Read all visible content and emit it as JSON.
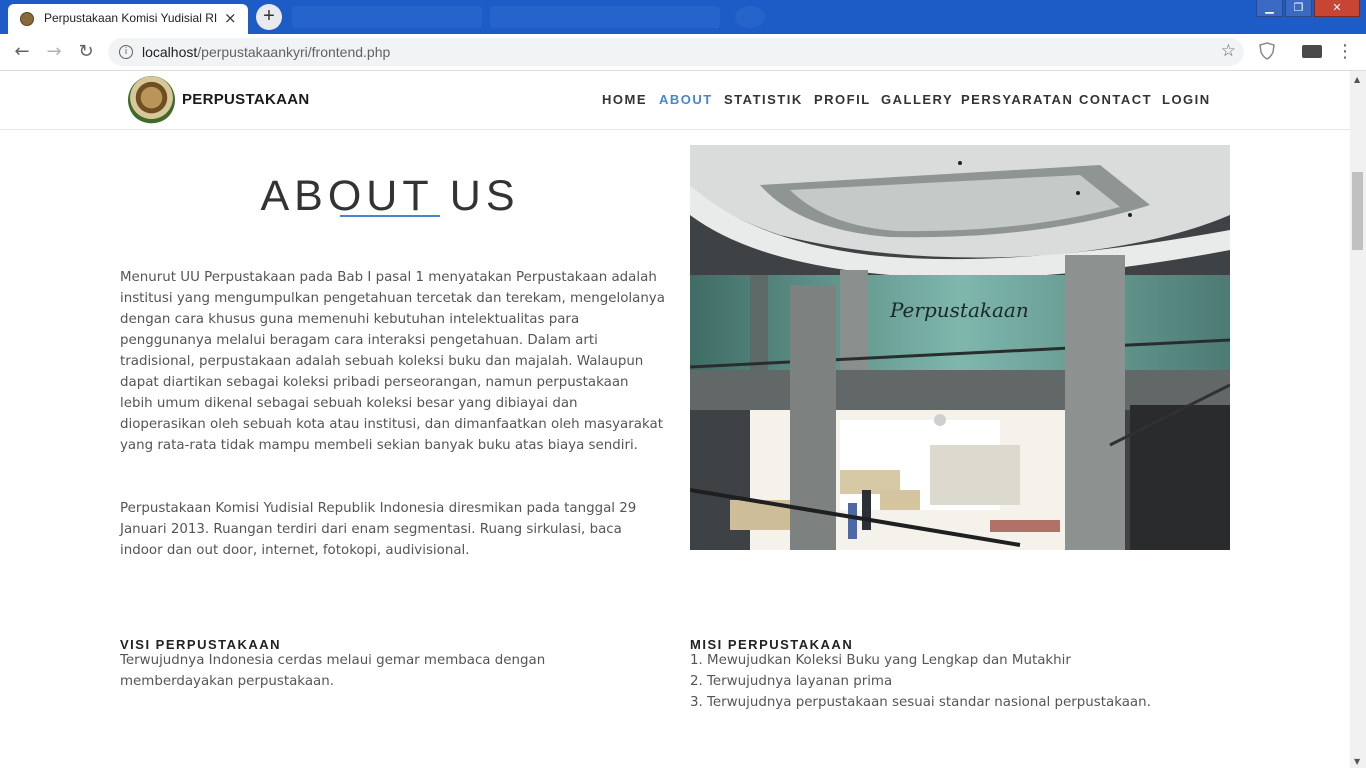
{
  "browser": {
    "tab_title": "Perpustakaan Komisi Yudisial RI",
    "tab_close": "×",
    "new_tab": "+",
    "url_host": "localhost",
    "url_path": "/perpustakaankyri/frontend.php",
    "back": "←",
    "forward": "→",
    "reload": "↻",
    "info": "i",
    "bookmark": "☆",
    "menu": "⋮",
    "window": {
      "minimize": "▁",
      "maximize": "❐",
      "close": "✕"
    }
  },
  "site": {
    "logo_text": "PERPUSTAKAAN",
    "nav": [
      {
        "label": "HOME",
        "active": false
      },
      {
        "label": "ABOUT",
        "active": true
      },
      {
        "label": "STATISTIK",
        "active": false
      },
      {
        "label": "PROFIL",
        "active": false
      },
      {
        "label": "GALLERY",
        "active": false
      },
      {
        "label": "PERSYARATAN",
        "active": false
      },
      {
        "label": "CONTACT",
        "active": false
      },
      {
        "label": "LOGIN",
        "active": false
      }
    ],
    "accent_color": "#4a86cf"
  },
  "about": {
    "title": "ABOUT US",
    "paragraph1": "Menurut UU Perpustakaan pada Bab I pasal 1 menyatakan Perpustakaan adalah institusi yang mengumpulkan pengetahuan tercetak dan terekam, mengelolanya dengan cara khusus guna memenuhi kebutuhan intelektualitas para penggunanya melalui beragam cara interaksi pengetahuan. Dalam arti tradisional, perpustakaan adalah sebuah koleksi buku dan majalah. Walaupun dapat diartikan sebagai koleksi pribadi perseorangan, namun perpustakaan lebih umum dikenal sebagai sebuah koleksi besar yang dibiayai dan dioperasikan oleh sebuah kota atau institusi, dan dimanfaatkan oleh masyarakat yang rata-rata tidak mampu membeli sekian banyak buku atas biaya sendiri.",
    "paragraph2": "Perpustakaan Komisi Yudisial Republik Indonesia diresmikan pada tanggal 29 Januari 2013. Ruangan terdiri dari enam segmentasi. Ruang sirkulasi, baca indoor dan out door, internet, fotokopi, audivisional.",
    "photo_sign": "Perpustakaan"
  },
  "visi": {
    "heading": "VISI PERPUSTAKAAN",
    "text": "Terwujudnya Indonesia cerdas melaui gemar membaca dengan memberdayakan perpustakaan."
  },
  "misi": {
    "heading": "MISI PERPUSTAKAAN",
    "items": [
      "1. Mewujudkan Koleksi Buku yang Lengkap dan Mutakhir",
      "2. Terwujudnya layanan prima",
      "3. Terwujudnya perpustakaan sesuai standar nasional perpustakaan."
    ]
  }
}
